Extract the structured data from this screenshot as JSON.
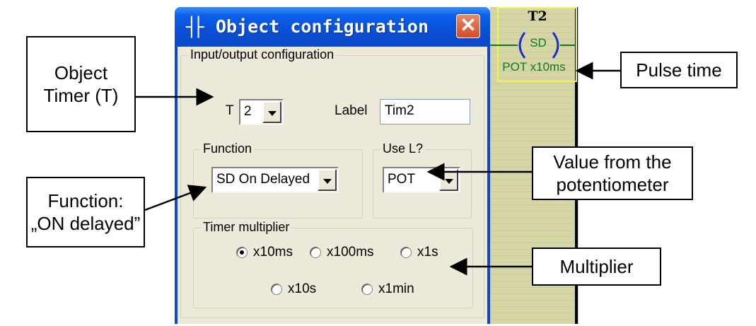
{
  "dialog": {
    "title": "Object configuration",
    "title_icon": "ladder-contact-icon",
    "close_icon": "close-icon",
    "io_group": {
      "legend": "Input/output configuration",
      "t_label": "T",
      "t_value": "2",
      "label_label": "Label",
      "label_value": "Tim2"
    },
    "function_group": {
      "legend": "Function",
      "value": "SD On Delayed"
    },
    "use_l_group": {
      "legend": "Use L?",
      "value": "POT"
    },
    "multiplier_group": {
      "legend": "Timer multiplier",
      "options": [
        "x10ms",
        "x100ms",
        "x1s",
        "x10s",
        "x1min"
      ],
      "selected": "x10ms"
    }
  },
  "ladder": {
    "name": "T2",
    "coil_label": "SD",
    "time_label": "POT x10ms",
    "colors": {
      "background": "#d5d5a5",
      "coil": "#0e7c1a",
      "highlight": "#f2f25a"
    }
  },
  "callouts": {
    "object_timer": "Object\nTimer (T)",
    "function": "Function:\n„ON delayed”",
    "pulse_time": "Pulse time",
    "value_pot": "Value from the\npotentiometer",
    "multiplier": "Multiplier"
  },
  "colors": {
    "titlebar": "#0a4fd6",
    "close_button": "#d54a28",
    "dialog_face": "#ece9d8"
  }
}
